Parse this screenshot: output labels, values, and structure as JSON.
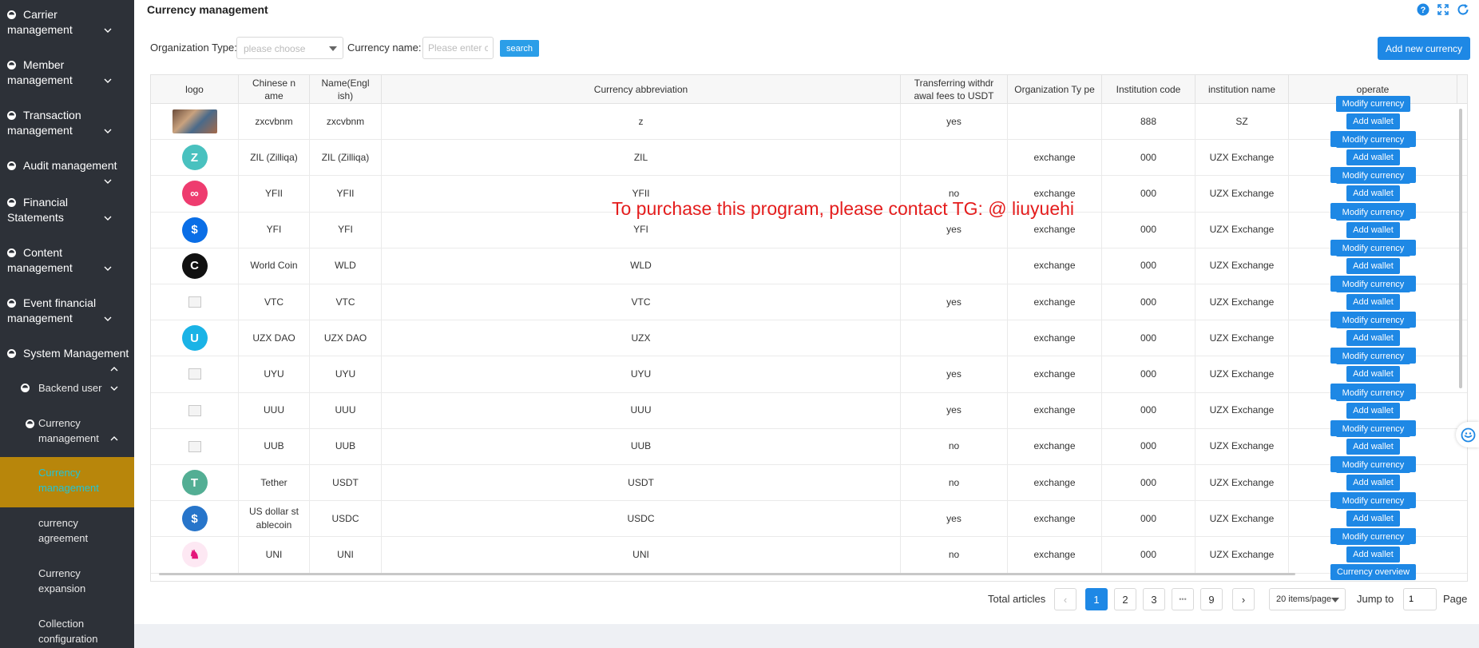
{
  "sidebar": {
    "items": [
      {
        "label": "Carrier management",
        "icon": "circle-half-icon",
        "chevron": "down"
      },
      {
        "label": "Member management",
        "icon": "circle-half-icon",
        "chevron": "down"
      },
      {
        "label": "Transaction management",
        "icon": "circle-half-icon",
        "chevron": "down"
      },
      {
        "label": "Audit management",
        "icon": "circle-half-icon",
        "chevron": "down"
      },
      {
        "label": "Financial Statements",
        "icon": "circle-half-icon",
        "chevron": "down"
      },
      {
        "label": "Content management",
        "icon": "circle-half-icon",
        "chevron": "down"
      },
      {
        "label": "Event financial management",
        "icon": "circle-half-icon",
        "chevron": "down"
      },
      {
        "label": "System Management",
        "icon": "circle-half-icon",
        "chevron": "up"
      }
    ],
    "sub_items": [
      {
        "label": "Backend user",
        "chevron": "down"
      },
      {
        "label": "Currency management",
        "chevron": "up"
      }
    ],
    "leaf_items": [
      {
        "label": "Currency management",
        "active": true
      },
      {
        "label": "currency agreement",
        "active": false
      },
      {
        "label": "Currency expansion",
        "active": false
      },
      {
        "label": "Collection configuration",
        "active": false
      }
    ],
    "active_color": "#b8860b",
    "active_text_color": "#20c5d8"
  },
  "header": {
    "title": "Currency management",
    "icons": [
      "help-icon",
      "fullscreen-icon",
      "refresh-icon"
    ]
  },
  "filters": {
    "org_type_label": "Organization Type:",
    "org_type_placeholder": "please choose",
    "currency_name_label": "Currency name:",
    "currency_name_placeholder": "Please enter cu",
    "search_label": "search",
    "add_label": "Add new currency"
  },
  "table": {
    "columns": [
      "logo",
      "Chinese n ame",
      "Name(Engl ish)",
      "Currency abbreviation",
      "Transferring withdr awal fees to USDT",
      "Organization Ty pe",
      "Institution code",
      "institution name",
      "operate"
    ],
    "actions": {
      "modify": "Modify currency",
      "wallet": "Add wallet",
      "overview": "Currency overview"
    },
    "rows": [
      {
        "logo": "photo",
        "cn": "zxcvbnm",
        "en": "zxcvbnm",
        "abbr": "z",
        "usdt": "yes",
        "org": "",
        "code": "888",
        "inst": "SZ"
      },
      {
        "logo": "zil",
        "cn": "ZIL (Zilliqa)",
        "en": "ZIL (Zilliqa)",
        "abbr": "ZIL",
        "usdt": "",
        "org": "exchange",
        "code": "000",
        "inst": "UZX Exchange"
      },
      {
        "logo": "yfii",
        "cn": "YFII",
        "en": "YFII",
        "abbr": "YFII",
        "usdt": "no",
        "org": "exchange",
        "code": "000",
        "inst": "UZX Exchange"
      },
      {
        "logo": "yfi",
        "cn": "YFI",
        "en": "YFI",
        "abbr": "YFI",
        "usdt": "yes",
        "org": "exchange",
        "code": "000",
        "inst": "UZX Exchange"
      },
      {
        "logo": "wld",
        "cn": "World Coin",
        "en": "WLD",
        "abbr": "WLD",
        "usdt": "",
        "org": "exchange",
        "code": "000",
        "inst": "UZX Exchange"
      },
      {
        "logo": "broken",
        "cn": "VTC",
        "en": "VTC",
        "abbr": "VTC",
        "usdt": "yes",
        "org": "exchange",
        "code": "000",
        "inst": "UZX Exchange"
      },
      {
        "logo": "uzx",
        "cn": "UZX DAO",
        "en": "UZX DAO",
        "abbr": "UZX",
        "usdt": "",
        "org": "exchange",
        "code": "000",
        "inst": "UZX Exchange"
      },
      {
        "logo": "broken",
        "cn": "UYU",
        "en": "UYU",
        "abbr": "UYU",
        "usdt": "yes",
        "org": "exchange",
        "code": "000",
        "inst": "UZX Exchange"
      },
      {
        "logo": "broken",
        "cn": "UUU",
        "en": "UUU",
        "abbr": "UUU",
        "usdt": "yes",
        "org": "exchange",
        "code": "000",
        "inst": "UZX Exchange"
      },
      {
        "logo": "broken",
        "cn": "UUB",
        "en": "UUB",
        "abbr": "UUB",
        "usdt": "no",
        "org": "exchange",
        "code": "000",
        "inst": "UZX Exchange"
      },
      {
        "logo": "usdt",
        "cn": "Tether",
        "en": "USDT",
        "abbr": "USDT",
        "usdt": "no",
        "org": "exchange",
        "code": "000",
        "inst": "UZX Exchange"
      },
      {
        "logo": "usdc",
        "cn": "US dollar st ablecoin",
        "en": "USDC",
        "abbr": "USDC",
        "usdt": "yes",
        "org": "exchange",
        "code": "000",
        "inst": "UZX Exchange"
      },
      {
        "logo": "uni",
        "cn": "UNI",
        "en": "UNI",
        "abbr": "UNI",
        "usdt": "no",
        "org": "exchange",
        "code": "000",
        "inst": "UZX Exchange"
      }
    ]
  },
  "watermark": "To purchase this program, please contact TG: @ liuyuehi",
  "pagination": {
    "total_label": "Total articles",
    "pages": [
      "1",
      "2",
      "3",
      "•••",
      "9"
    ],
    "current": "1",
    "prev": "‹",
    "next": "›",
    "page_size": "20 items/page",
    "jump_label": "Jump to",
    "jump_value": "1",
    "page_label": "Page"
  },
  "colors": {
    "primary": "#1e88e5",
    "search": "#2b9ee8",
    "sidebar_bg": "#2d3138",
    "watermark": "#e41d1d"
  }
}
